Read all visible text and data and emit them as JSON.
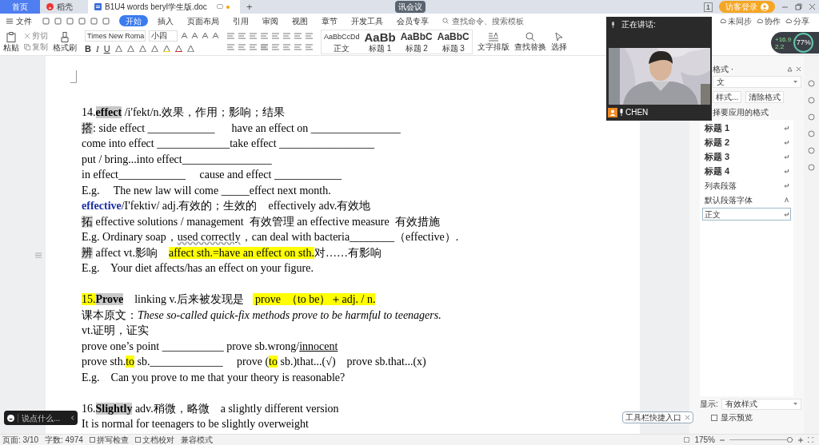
{
  "tabs": [
    {
      "label": "首页",
      "kind": "home",
      "selected": false
    },
    {
      "label": "稻壳",
      "kind": "app",
      "selected": false
    },
    {
      "label": "B1U4 words beryl学生版.doc",
      "kind": "doc",
      "selected": true
    }
  ],
  "new_tab": "+",
  "title_bar": {
    "meeting_badge": "讯会议",
    "page_count": "1",
    "login": "访客登录"
  },
  "menu": {
    "file": "文件",
    "tabs": [
      {
        "label": "开始",
        "selected": true
      },
      {
        "label": "插入",
        "selected": false
      },
      {
        "label": "页面布局",
        "selected": false
      },
      {
        "label": "引用",
        "selected": false
      },
      {
        "label": "审阅",
        "selected": false
      },
      {
        "label": "视图",
        "selected": false
      },
      {
        "label": "章节",
        "selected": false
      },
      {
        "label": "开发工具",
        "selected": false
      },
      {
        "label": "会员专享",
        "selected": false
      }
    ],
    "search": {
      "placeholder": "查找命令、搜索模板"
    },
    "actions": [
      "未同步",
      "协作",
      "分享"
    ]
  },
  "ribbon": {
    "paste": "粘贴",
    "cut": "剪切",
    "copy": "复制",
    "format_painter": "格式刷",
    "font": "Times New Roma",
    "size": "小四",
    "format_buttons": [
      "B",
      "I",
      "U"
    ],
    "styles": [
      {
        "sample": "AaBbCcDd",
        "label": "正文",
        "kind": "small"
      },
      {
        "sample": "AaBb",
        "label": "标题 1",
        "kind": "big"
      },
      {
        "sample": "AaBbC",
        "label": "标题 2",
        "kind": "medium"
      },
      {
        "sample": "AaBbC",
        "label": "标题 3",
        "kind": "medium"
      }
    ],
    "tools": [
      "文字排版",
      "查找替换",
      "选择"
    ]
  },
  "document": {
    "sections": [
      {
        "lines": [
          {
            "segments": [
              {
                "kind": "plain",
                "t": "14."
              },
              {
                "kind": "bold-shaded",
                "t": "effect"
              },
              {
                "kind": "plain",
                "t": " /i'fekt/n.效果，作用；影响；结果"
              }
            ]
          },
          {
            "segments": [
              {
                "kind": "shaded",
                "t": "搭"
              },
              {
                "kind": "plain",
                "t": ": side effect ____________      have an effect on ________________"
              }
            ]
          },
          {
            "segments": [
              {
                "kind": "plain",
                "t": "come into effect _____________take effect _________________"
              }
            ]
          },
          {
            "segments": [
              {
                "kind": "plain",
                "t": "put / bring...into effect________________"
              }
            ]
          },
          {
            "segments": [
              {
                "kind": "plain",
                "t": "in effect____________     cause and effect ____________"
              }
            ]
          },
          {
            "segments": [
              {
                "kind": "plain",
                "t": "E.g.     The new law will come _____effect next month."
              }
            ]
          },
          {
            "segments": [
              {
                "kind": "blue-bold",
                "t": "effective"
              },
              {
                "kind": "plain",
                "t": "/I'fektiv/ adj.有效的；生效的    effectively adv.有效地"
              }
            ]
          },
          {
            "segments": [
              {
                "kind": "shaded",
                "t": "拓"
              },
              {
                "kind": "plain",
                "t": " effective solutions / management  有效管理 an effective measure  有效措施"
              }
            ]
          },
          {
            "segments": [
              {
                "kind": "plain",
                "t": "E.g. Ordinary soap，"
              },
              {
                "kind": "spell-flagged",
                "t": "used correctly"
              },
              {
                "kind": "plain",
                "t": "，can deal with bacteria________（effective）."
              }
            ]
          },
          {
            "segments": [
              {
                "kind": "shaded",
                "t": "辨"
              },
              {
                "kind": "plain",
                "t": " affect vt.影响    "
              },
              {
                "kind": "highlighted",
                "t": "affect sth.=have an effect on sth."
              },
              {
                "kind": "plain",
                "t": "对……有影响"
              }
            ]
          },
          {
            "segments": [
              {
                "kind": "plain",
                "t": "E.g.    Your diet affects/has an effect on your figure."
              }
            ]
          }
        ]
      },
      {
        "lines": [
          {
            "segments": [
              {
                "kind": "highlighted",
                "t": "15."
              },
              {
                "kind": "bold-shaded",
                "t": "Prove"
              },
              {
                "kind": "plain",
                "t": "    linking v.后来被发现是   "
              },
              {
                "kind": "highlighted",
                "t": " prove  （to be）＋adj. / n."
              }
            ]
          },
          {
            "segments": [
              {
                "kind": "plain",
                "t": "课本原文："
              },
              {
                "kind": "italic",
                "t": "These so-called quick-fix methods prove to be harmful to teenagers."
              }
            ]
          },
          {
            "segments": [
              {
                "kind": "plain",
                "t": "vt.证明，证实"
              }
            ]
          },
          {
            "segments": [
              {
                "kind": "plain",
                "t": "prove one’s point ___________ prove sb.wrong/"
              },
              {
                "kind": "underlined",
                "t": "innocent"
              }
            ]
          },
          {
            "segments": [
              {
                "kind": "plain",
                "t": "prove sth."
              },
              {
                "kind": "highlighted",
                "t": "to"
              },
              {
                "kind": "plain",
                "t": " sb._____________     prove ("
              },
              {
                "kind": "highlighted",
                "t": "to"
              },
              {
                "kind": "plain",
                "t": " sb.)that...(√)    prove sb.that...(x)"
              }
            ]
          },
          {
            "segments": [
              {
                "kind": "plain",
                "t": "E.g.    Can you prove to me that your theory is reasonable?"
              }
            ]
          }
        ]
      },
      {
        "lines": [
          {
            "segments": [
              {
                "kind": "plain",
                "t": "16."
              },
              {
                "kind": "bold-shaded",
                "t": "Slightly"
              },
              {
                "kind": "plain",
                "t": " adv.稍微，略微    a slightly different version"
              }
            ]
          },
          {
            "segments": [
              {
                "kind": "plain",
                "t": "It is normal for teenagers to be slightly overweight"
              }
            ]
          }
        ]
      }
    ]
  },
  "video": {
    "status": "正在讲话:",
    "speaker": "CHEN",
    "kind": "picture"
  },
  "network": {
    "up": "+16.9",
    "down": "2.2",
    "percent": "77%"
  },
  "styles_panel": {
    "title": "格式 ·",
    "current": "文",
    "buttons": [
      "样式...",
      "清除格式"
    ],
    "prompt": "择要应用的格式",
    "items": [
      {
        "label": "标题 1",
        "kind": "heading",
        "selected": false
      },
      {
        "label": "标题 2",
        "kind": "heading",
        "selected": false
      },
      {
        "label": "标题 3",
        "kind": "heading",
        "selected": false
      },
      {
        "label": "标题 4",
        "kind": "heading",
        "selected": false
      },
      {
        "label": "列表段落",
        "kind": "paragraph",
        "selected": false
      },
      {
        "label": "默认段落字体",
        "kind": "character",
        "selected": false
      },
      {
        "label": "正文",
        "kind": "paragraph",
        "selected": true
      }
    ],
    "show_label": "显示:",
    "show_value": "有效样式",
    "preview": {
      "label": "显示预览",
      "checked": false
    }
  },
  "chat": {
    "placeholder": "说点什么..."
  },
  "tooltip": {
    "text": "工具栏快捷入口"
  },
  "status_bar": {
    "page": "页面: 3/10",
    "words": "字数: 4974",
    "spell": "拼写检查",
    "proof": "文档校对",
    "mode": "兼容模式",
    "zoom": "175%",
    "zoom_slider": {
      "level": 0.95
    }
  }
}
